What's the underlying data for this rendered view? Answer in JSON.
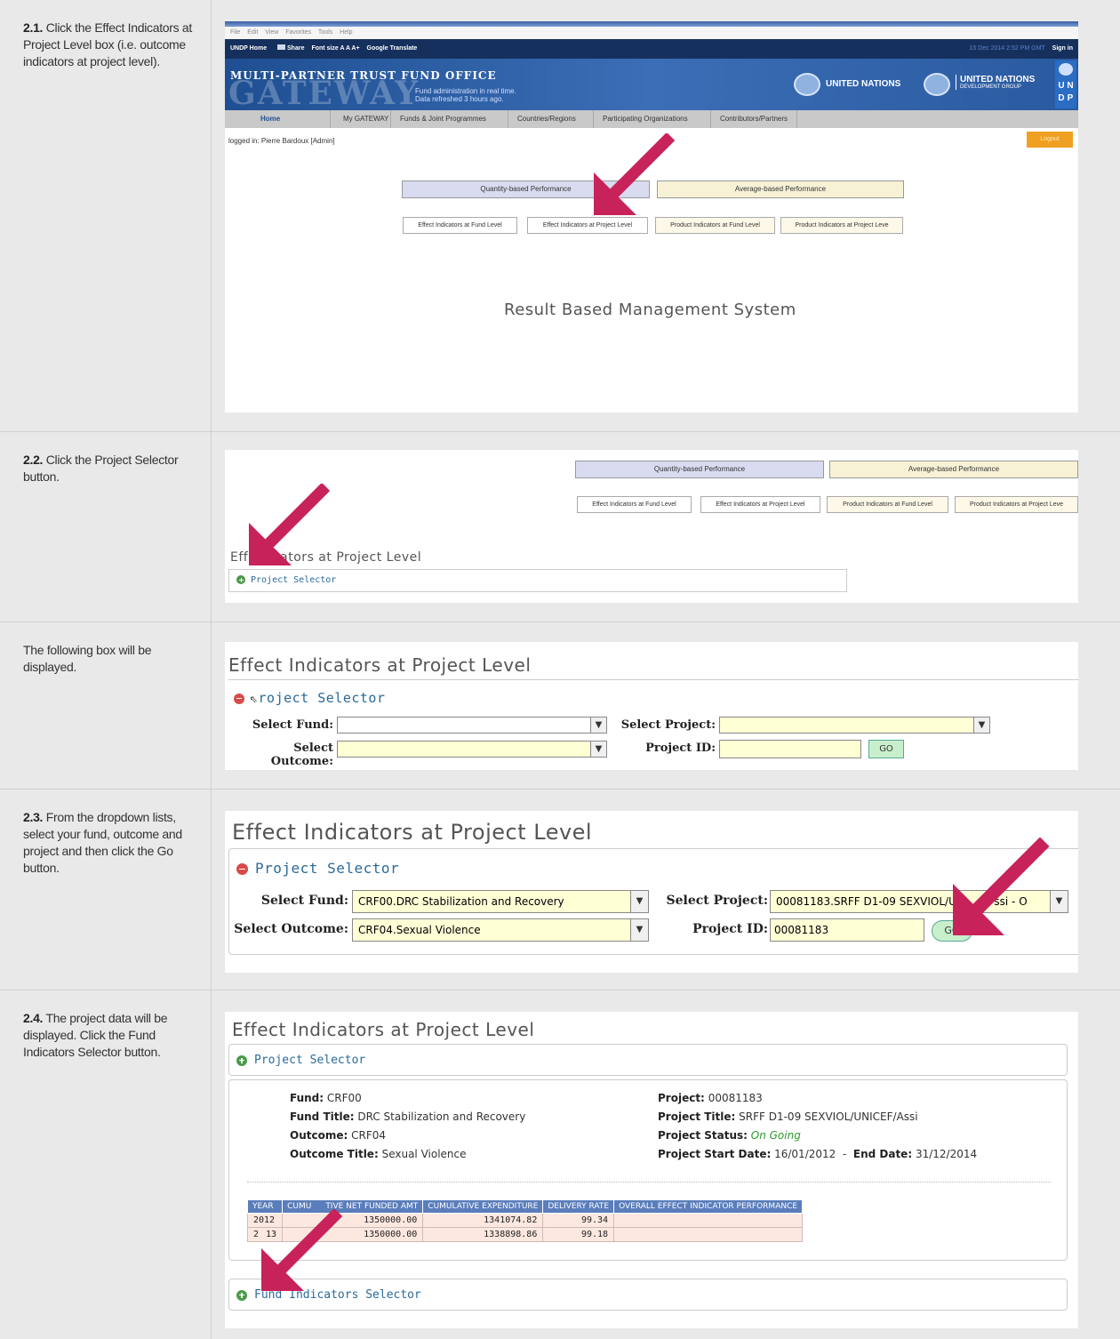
{
  "steps": [
    {
      "num": "2.1.",
      "text": " Click the Effect Indicators at Project Level box (i.e. outcome indicators at project level)."
    },
    {
      "num": "2.2.",
      "text": " Click the Project Selector button."
    },
    {
      "num": "",
      "text": "The following box will be displayed."
    },
    {
      "num": "2.3.",
      "text": " From the dropdown lists, select your fund, outcome and project and then click the Go button."
    },
    {
      "num": "2.4.",
      "text": " The project data will be displayed. Click the Fund Indicators Selector button."
    }
  ],
  "browser": {
    "menu": [
      "File",
      "Edit",
      "View",
      "Favorites",
      "Tools",
      "Help"
    ],
    "toolbar": [
      "UNDP Home",
      "Share",
      "Font size A A A+",
      "Google Translate"
    ],
    "toolbar_right": [
      "15 Dec 2014 2:52 PM GMT",
      "Sign in"
    ]
  },
  "gateway": {
    "title": "MULTI-PARTNER TRUST FUND OFFICE",
    "logo": "GATEWAY",
    "tag1": "Fund administration in real time.",
    "tag2": "Data refreshed 3 hours ago.",
    "un": "UNITED NATIONS",
    "undg1": "UNITED NATIONS",
    "undg2": "DEVELOPMENT GROUP",
    "undp": [
      "U",
      "N",
      "D",
      "P"
    ],
    "nav": [
      "Home",
      "My GATEWAY",
      "Funds & Joint Programmes",
      "Countries/Regions",
      "Participating Organizations",
      "Contributors/Partners"
    ],
    "logged": "logged in: Pierre Bardoux [Admin]",
    "logout": "Logout",
    "rbms": "Result Based Management System"
  },
  "perf": {
    "quantity": "Quantity-based Performance",
    "average": "Average-based Performance",
    "b1": "Effect Indicators at Fund Level",
    "b2": "Effect Indicators at Project Level",
    "b3": "Product Indicators at Fund Level",
    "b4": "Product Indicators at Project Leve",
    "b4b": "Product Indicators at Project Leve"
  },
  "eipl": "Effect Indicators at Project Level",
  "eipl_partial": "dicators at Project Level",
  "eipl_partial_pre": "Eff",
  "project_selector": "Project Selector",
  "project_selector_cut": "roject Selector",
  "form": {
    "fund_label": "Select Fund:",
    "outcome_label": "Select Outcome:",
    "project_label": "Select Project:",
    "pid_label": "Project ID:",
    "go": "GO",
    "fund_value": "CRF00.DRC Stabilization and Recovery",
    "outcome_value": "CRF04.Sexual Violence",
    "project_value_a": "00081183.SRFF D1-09 SEXVIOL/UNI",
    "project_value_b": "ssi - O",
    "pid_value": "00081183"
  },
  "details": {
    "fund_k": "Fund:",
    "fund_v": "CRF00",
    "ftitle_k": "Fund Title:",
    "ftitle_v": "DRC Stabilization and Recovery",
    "outcome_k": "Outcome:",
    "outcome_v": "CRF04",
    "otitle_k": "Outcome Title:",
    "otitle_v": "Sexual Violence",
    "project_k": "Project:",
    "project_v": "00081183",
    "ptitle_k": "Project Title:",
    "ptitle_v": "SRFF D1-09 SEXVIOL/UNICEF/Assi",
    "pstatus_k": "Project Status:",
    "pstatus_v": "On Going",
    "pstart_k": "Project Start Date:",
    "pstart_v": "16/01/2012",
    "pend_k": "End Date:",
    "pend_v": "31/12/2014"
  },
  "table": {
    "headers": [
      "YEAR",
      "CUMU",
      "TIVE NET FUNDED AMT",
      "CUMULATIVE EXPENDITURE",
      "DELIVERY RATE",
      "OVERALL EFFECT INDICATOR PERFORMANCE"
    ],
    "rows": [
      [
        "2012",
        "1350000.00",
        "1341074.82",
        "99.34",
        ""
      ],
      [
        "2",
        "13",
        "1350000.00",
        "1338898.86",
        "99.18",
        ""
      ]
    ]
  },
  "fund_indicators_selector": "Fund Indicators Selector",
  "colors": {
    "arrow": "#c8225a",
    "header_blue": "#1d4f91",
    "nav_gray": "#c9c9c9",
    "logout": "#f0a020"
  }
}
